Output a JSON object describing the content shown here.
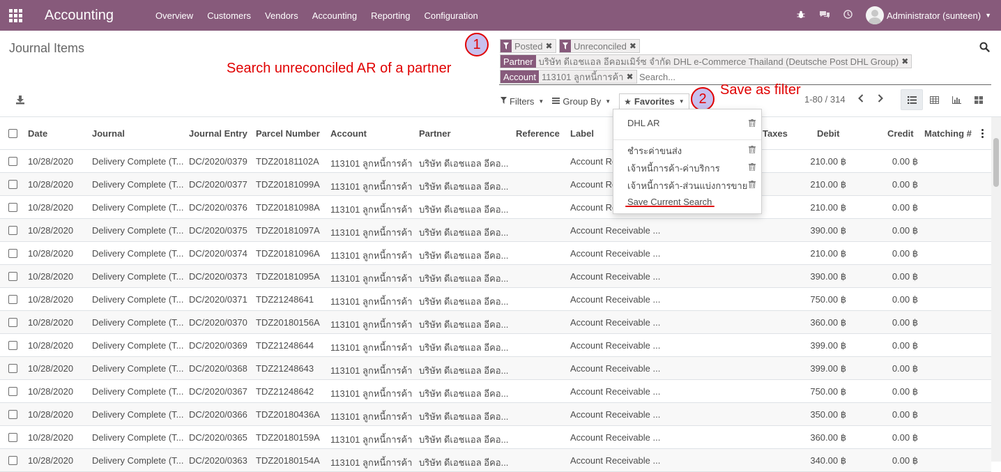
{
  "navbar": {
    "brand": "Accounting",
    "menu": [
      "Overview",
      "Customers",
      "Vendors",
      "Accounting",
      "Reporting",
      "Configuration"
    ],
    "user": "Administrator (sunteen)"
  },
  "breadcrumb": "Journal Items",
  "search": {
    "facets": [
      {
        "type": "filter",
        "value": "Posted"
      },
      {
        "type": "filter",
        "value": "Unreconciled"
      },
      {
        "label": "Partner",
        "value": "บริษัท ดีเอชแอล อีคอมเมิร์ซ จำกัด DHL e-Commerce Thailand (Deutsche Post DHL Group)"
      },
      {
        "label": "Account",
        "value": "113101 ลูกหนี้การค้า"
      }
    ],
    "placeholder": "Search..."
  },
  "filters_bar": {
    "filters": "Filters",
    "group_by": "Group By",
    "favorites": "Favorites"
  },
  "pager": "1-80 / 314",
  "annotations": {
    "step1_num": "1",
    "step1_text": "Search unreconciled AR of a partner",
    "step2_num": "2",
    "step2_text": "Save as filter"
  },
  "favorites_menu": {
    "items": [
      "DHL AR",
      "ชำระค่าขนส่ง",
      "เจ้าหนี้การค้า-ค่าบริการ",
      "เจ้าหนี้การค้า-ส่วนแบ่งการขาย"
    ],
    "save_current": "Save Current Search"
  },
  "table": {
    "columns": [
      "Date",
      "Journal",
      "Journal Entry",
      "Parcel Number",
      "Account",
      "Partner",
      "Reference",
      "Label",
      "Taxes",
      "Debit",
      "Credit",
      "Matching #"
    ],
    "rows": [
      [
        "10/28/2020",
        "Delivery Complete (T...",
        "DC/2020/0379",
        "TDZ20181102A",
        "113101 ลูกหนี้การค้า",
        "บริษัท ดีเอชแอล อีคอ...",
        "",
        "Account Receivable ...",
        "",
        "210.00 ฿",
        "0.00 ฿",
        ""
      ],
      [
        "10/28/2020",
        "Delivery Complete (T...",
        "DC/2020/0377",
        "TDZ20181099A",
        "113101 ลูกหนี้การค้า",
        "บริษัท ดีเอชแอล อีคอ...",
        "",
        "Account Receivable ...",
        "",
        "210.00 ฿",
        "0.00 ฿",
        ""
      ],
      [
        "10/28/2020",
        "Delivery Complete (T...",
        "DC/2020/0376",
        "TDZ20181098A",
        "113101 ลูกหนี้การค้า",
        "บริษัท ดีเอชแอล อีคอ...",
        "",
        "Account Receivable ...",
        "",
        "210.00 ฿",
        "0.00 ฿",
        ""
      ],
      [
        "10/28/2020",
        "Delivery Complete (T...",
        "DC/2020/0375",
        "TDZ20181097A",
        "113101 ลูกหนี้การค้า",
        "บริษัท ดีเอชแอล อีคอ...",
        "",
        "Account Receivable ...",
        "",
        "390.00 ฿",
        "0.00 ฿",
        ""
      ],
      [
        "10/28/2020",
        "Delivery Complete (T...",
        "DC/2020/0374",
        "TDZ20181096A",
        "113101 ลูกหนี้การค้า",
        "บริษัท ดีเอชแอล อีคอ...",
        "",
        "Account Receivable ...",
        "",
        "210.00 ฿",
        "0.00 ฿",
        ""
      ],
      [
        "10/28/2020",
        "Delivery Complete (T...",
        "DC/2020/0373",
        "TDZ20181095A",
        "113101 ลูกหนี้การค้า",
        "บริษัท ดีเอชแอล อีคอ...",
        "",
        "Account Receivable ...",
        "",
        "390.00 ฿",
        "0.00 ฿",
        ""
      ],
      [
        "10/28/2020",
        "Delivery Complete (T...",
        "DC/2020/0371",
        "TDZ21248641",
        "113101 ลูกหนี้การค้า",
        "บริษัท ดีเอชแอล อีคอ...",
        "",
        "Account Receivable ...",
        "",
        "750.00 ฿",
        "0.00 ฿",
        ""
      ],
      [
        "10/28/2020",
        "Delivery Complete (T...",
        "DC/2020/0370",
        "TDZ20180156A",
        "113101 ลูกหนี้การค้า",
        "บริษัท ดีเอชแอล อีคอ...",
        "",
        "Account Receivable ...",
        "",
        "360.00 ฿",
        "0.00 ฿",
        ""
      ],
      [
        "10/28/2020",
        "Delivery Complete (T...",
        "DC/2020/0369",
        "TDZ21248644",
        "113101 ลูกหนี้การค้า",
        "บริษัท ดีเอชแอล อีคอ...",
        "",
        "Account Receivable ...",
        "",
        "399.00 ฿",
        "0.00 ฿",
        ""
      ],
      [
        "10/28/2020",
        "Delivery Complete (T...",
        "DC/2020/0368",
        "TDZ21248643",
        "113101 ลูกหนี้การค้า",
        "บริษัท ดีเอชแอล อีคอ...",
        "",
        "Account Receivable ...",
        "",
        "399.00 ฿",
        "0.00 ฿",
        ""
      ],
      [
        "10/28/2020",
        "Delivery Complete (T...",
        "DC/2020/0367",
        "TDZ21248642",
        "113101 ลูกหนี้การค้า",
        "บริษัท ดีเอชแอล อีคอ...",
        "",
        "Account Receivable ...",
        "",
        "750.00 ฿",
        "0.00 ฿",
        ""
      ],
      [
        "10/28/2020",
        "Delivery Complete (T...",
        "DC/2020/0366",
        "TDZ20180436A",
        "113101 ลูกหนี้การค้า",
        "บริษัท ดีเอชแอล อีคอ...",
        "",
        "Account Receivable ...",
        "",
        "350.00 ฿",
        "0.00 ฿",
        ""
      ],
      [
        "10/28/2020",
        "Delivery Complete (T...",
        "DC/2020/0365",
        "TDZ20180159A",
        "113101 ลูกหนี้การค้า",
        "บริษัท ดีเอชแอล อีคอ...",
        "",
        "Account Receivable ...",
        "",
        "360.00 ฿",
        "0.00 ฿",
        ""
      ],
      [
        "10/28/2020",
        "Delivery Complete (T...",
        "DC/2020/0363",
        "TDZ20180154A",
        "113101 ลูกหนี้การค้า",
        "บริษัท ดีเอชแอล อีคอ...",
        "",
        "Account Receivable ...",
        "",
        "340.00 ฿",
        "0.00 ฿",
        ""
      ]
    ]
  },
  "colors": {
    "brand": "#875a7b",
    "annotation": "#e00000"
  }
}
